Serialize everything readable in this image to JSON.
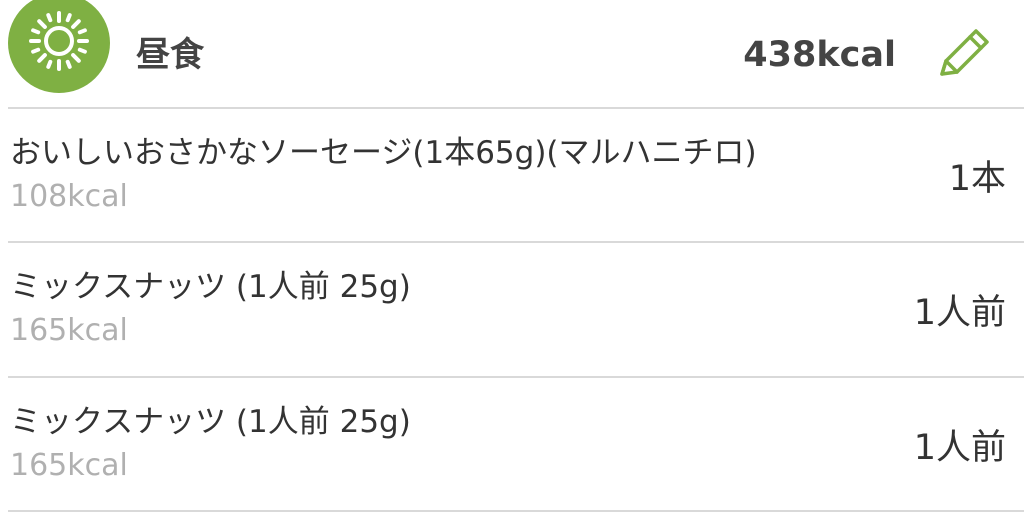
{
  "meal": {
    "icon": "sun-icon",
    "title": "昼食",
    "total_kcal": "438kcal",
    "edit_icon": "pencil-icon",
    "accent_color": "#7fb043"
  },
  "foods": [
    {
      "name": "おいしいおさかなソーセージ(1本65g)(マルハニチロ)",
      "kcal": "108kcal",
      "quantity": "1本"
    },
    {
      "name": "ミックスナッツ (1人前 25g)",
      "kcal": "165kcal",
      "quantity": "1人前"
    },
    {
      "name": "ミックスナッツ (1人前 25g)",
      "kcal": "165kcal",
      "quantity": "1人前"
    }
  ]
}
